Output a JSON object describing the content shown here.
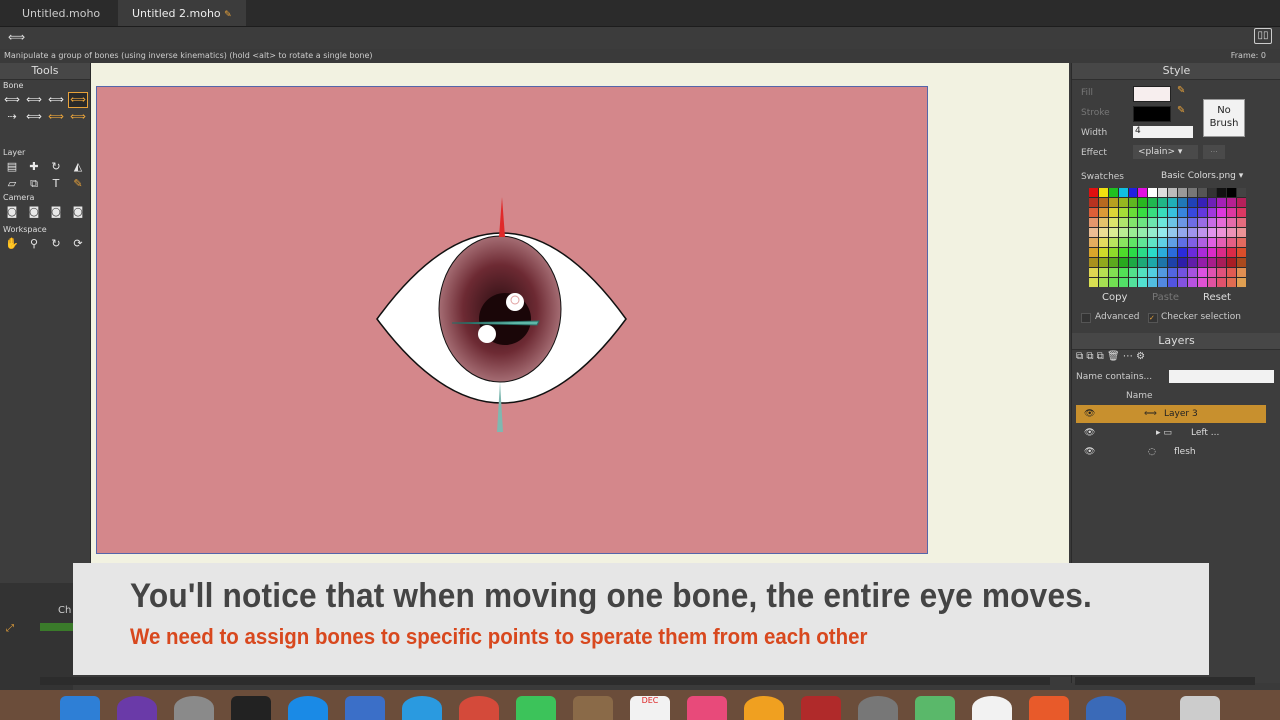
{
  "tabs": [
    {
      "label": "Untitled.moho"
    },
    {
      "label": "Untitled 2.moho"
    }
  ],
  "status": {
    "hint": "Manipulate a group of bones (using inverse kinematics) (hold <alt> to rotate a single bone)",
    "frame": "Frame: 0"
  },
  "tools": {
    "title": "Tools",
    "groups": {
      "bone": "Bone",
      "layer": "Layer",
      "camera": "Camera",
      "workspace": "Workspace"
    }
  },
  "style": {
    "title": "Style",
    "fill_label": "Fill",
    "stroke_label": "Stroke",
    "width_label": "Width",
    "width_value": "4",
    "effect_label": "Effect",
    "effect_value": "<plain>",
    "no_brush": "No Brush",
    "swatches_label": "Swatches",
    "swatches_value": "Basic Colors.png",
    "copy": "Copy",
    "paste": "Paste",
    "reset": "Reset",
    "advanced": "Advanced",
    "checker": "Checker selection",
    "fill_color": "#f7eeee",
    "stroke_color": "#000000"
  },
  "layers": {
    "title": "Layers",
    "filter_label": "Name contains...",
    "name_header": "Name",
    "rows": [
      {
        "name": "Layer 3",
        "selected": true
      },
      {
        "name": "Left ..."
      },
      {
        "name": "flesh"
      }
    ]
  },
  "timeline": {
    "tab_fragment": "Ch"
  },
  "caption": {
    "line1": "You'll notice that when moving one bone, the entire eye moves.",
    "line2": "We need to assign bones to specific points to sperate them from each other"
  },
  "dock": {
    "calendar_month": "DEC"
  },
  "colors": {
    "stage": "#d4878b",
    "accent": "#e8a23a",
    "caption_red": "#d8481e"
  }
}
